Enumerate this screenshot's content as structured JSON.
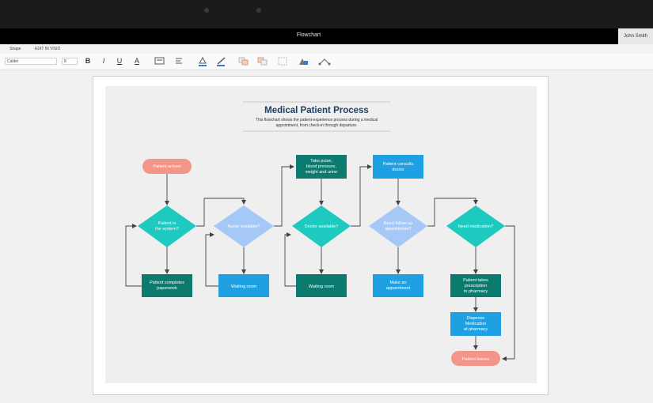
{
  "window": {
    "title": "Flowchart",
    "user": "John Smith"
  },
  "ribbon": {
    "tabs": [
      "Shape",
      "EDIT IN VISIO"
    ],
    "font": "Calibri",
    "font_size": "8"
  },
  "toolbar": {
    "bold": "B",
    "italic": "I",
    "underline": "U",
    "font_color": "A"
  },
  "diagram": {
    "title": "Medical Patient Process",
    "subtitle_line1": "This flowchart shows the patient-experience process during a medical",
    "subtitle_line2": "appointment, from check-in through departure.",
    "nodes": {
      "arrives": "Patient arrives",
      "in_system": [
        "Patient in",
        "the system?"
      ],
      "nurse": "Nurse available?",
      "doctor": "Doctor available?",
      "followup": [
        "Need follow-up",
        "appointment?"
      ],
      "medication": "Need medication?",
      "paperwork": [
        "Patient completes",
        "paperwork"
      ],
      "waiting1": "Waiting room",
      "vitals": [
        "Take pulse,",
        "blood pressure,",
        "weight and urine"
      ],
      "waiting2": "Waiting room",
      "consults": [
        "Patient consults",
        "doctor"
      ],
      "appointment": [
        "Make an",
        "appointment"
      ],
      "prescription": [
        "Patient takes",
        "prescription",
        "to pharmacy"
      ],
      "dispense": [
        "Dispense",
        "Medication",
        "at pharmacy"
      ],
      "leaves": "Patient leaves"
    },
    "colors": {
      "terminal": "#f4958a",
      "diamond_teal": "#1ec9c0",
      "diamond_blue": "#a6c8f7",
      "box_dark": "#0c7a6e",
      "box_blue": "#1fa0e3",
      "title": "#1d3f63"
    }
  }
}
